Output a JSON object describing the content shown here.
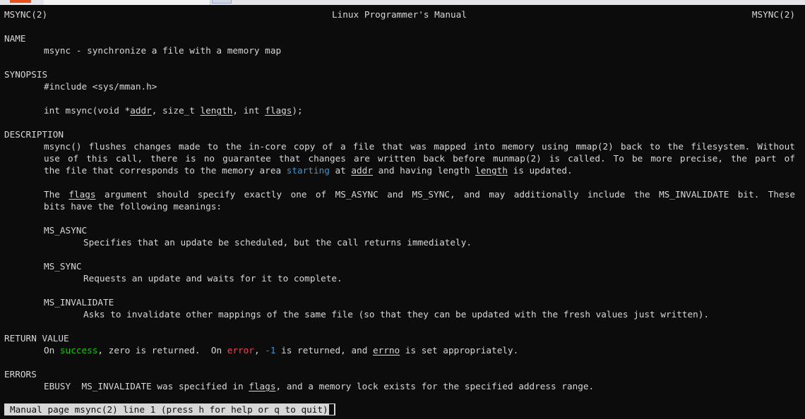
{
  "header": {
    "left": "MSYNC(2)",
    "center": "Linux Programmer's Manual",
    "right": "MSYNC(2)"
  },
  "sections": {
    "name": {
      "heading": "NAME",
      "text": "msync - synchronize a file with a memory map"
    },
    "synopsis": {
      "heading": "SYNOPSIS",
      "include": "#include <sys/mman.h>",
      "proto_start": "int msync(void *",
      "proto_addr": "addr",
      "proto_mid1": ", size_t ",
      "proto_length": "length",
      "proto_mid2": ", int ",
      "proto_flags": "flags",
      "proto_end": ");"
    },
    "description": {
      "heading": "DESCRIPTION",
      "p1_l1_words": [
        "msync()",
        "flushes",
        "changes",
        "made",
        "to",
        "the",
        "in-core",
        "copy",
        "of",
        "a",
        "file",
        "that",
        "was",
        "mapped",
        "into",
        "memory",
        "using",
        "mmap(2)",
        "back",
        "to",
        "the",
        "filesystem.",
        "Without"
      ],
      "p1_l2_words": [
        "use",
        "of",
        "this",
        "call,",
        "there",
        "is",
        "no",
        "guarantee",
        "that",
        "changes",
        "are",
        "written",
        "back",
        "before",
        "munmap(2)",
        "is",
        "called.",
        "To",
        "be",
        "more",
        "precise,",
        "the",
        "part",
        "of"
      ],
      "p1_l3_a": "the file that corresponds to the memory area ",
      "p1_l3_starting": "starting",
      "p1_l3_b": " at ",
      "p1_l3_addr": "addr",
      "p1_l3_c": " and having length ",
      "p1_l3_length": "length",
      "p1_l3_d": " is updated.",
      "p2_l1_the": "The",
      "p2_l1_flags": "flags",
      "p2_l1_words": [
        "argument",
        "should",
        "specify",
        "exactly",
        "one",
        "of",
        "MS_ASYNC",
        "and",
        "MS_SYNC,",
        "and",
        "may",
        "additionally",
        "include",
        "the",
        "MS_INVALIDATE",
        "bit.",
        "These"
      ],
      "p2_l2": "bits have the following meanings:",
      "ms_async_term": "MS_ASYNC",
      "ms_async_desc": "Specifies that an update be scheduled, but the call returns immediately.",
      "ms_sync_term": "MS_SYNC",
      "ms_sync_desc": "Requests an update and waits for it to complete.",
      "ms_invalidate_term": "MS_INVALIDATE",
      "ms_invalidate_desc": "Asks to invalidate other mappings of the same file (so that they can be updated with the fresh values just written)."
    },
    "return_value": {
      "heading": "RETURN VALUE",
      "a": "On ",
      "success": "success",
      "b": ", zero is returned.  On ",
      "error": "error",
      "c": ", ",
      "minus_one": "-1",
      "d": " is returned, and ",
      "errno": "errno",
      "e": " is set appropriately."
    },
    "errors": {
      "heading": "ERRORS",
      "a": "EBUSY  MS_INVALIDATE was specified in ",
      "flags": "flags",
      "b": ", and a memory lock exists for the specified address range."
    }
  },
  "status_bar": {
    "text": "Manual page msync(2) line 1 (press h for help or q to quit)"
  },
  "colors": {
    "background": "#0c0c0c",
    "foreground": "#d7d7d7",
    "highlight_cyan": "#3a96dd",
    "success_green": "#16c60c",
    "error_red": "#e74856"
  }
}
